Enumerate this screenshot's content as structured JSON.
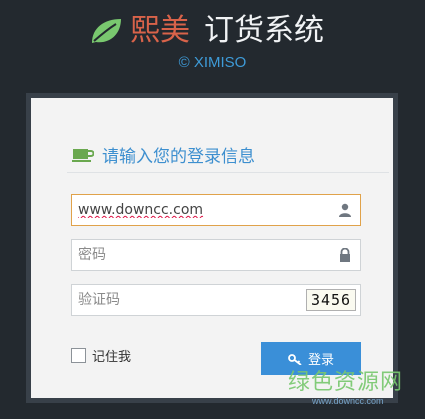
{
  "header": {
    "brand_red": "熙美",
    "brand_white": "订货系统",
    "copyright": "© XIMISO",
    "logo_icon": "leaf-icon"
  },
  "login": {
    "title": "请输入您的登录信息",
    "title_icon": "cup-icon",
    "username_value": "www.downcc.com",
    "username_icon": "user-icon",
    "password_placeholder": "密码",
    "password_icon": "lock-icon",
    "captcha_placeholder": "验证码",
    "captcha_text": "3456",
    "remember_label": "记住我",
    "remember_checked": false,
    "submit_label": "登录",
    "submit_icon": "key-icon"
  },
  "watermark": {
    "cn": "绿色资源网",
    "url": "www.downcc.com"
  },
  "colors": {
    "background": "#23292f",
    "brand_red": "#d9634a",
    "accent_blue": "#3a8fd8",
    "active_border": "#e0a24a",
    "leaf_green": "#79c86f"
  }
}
